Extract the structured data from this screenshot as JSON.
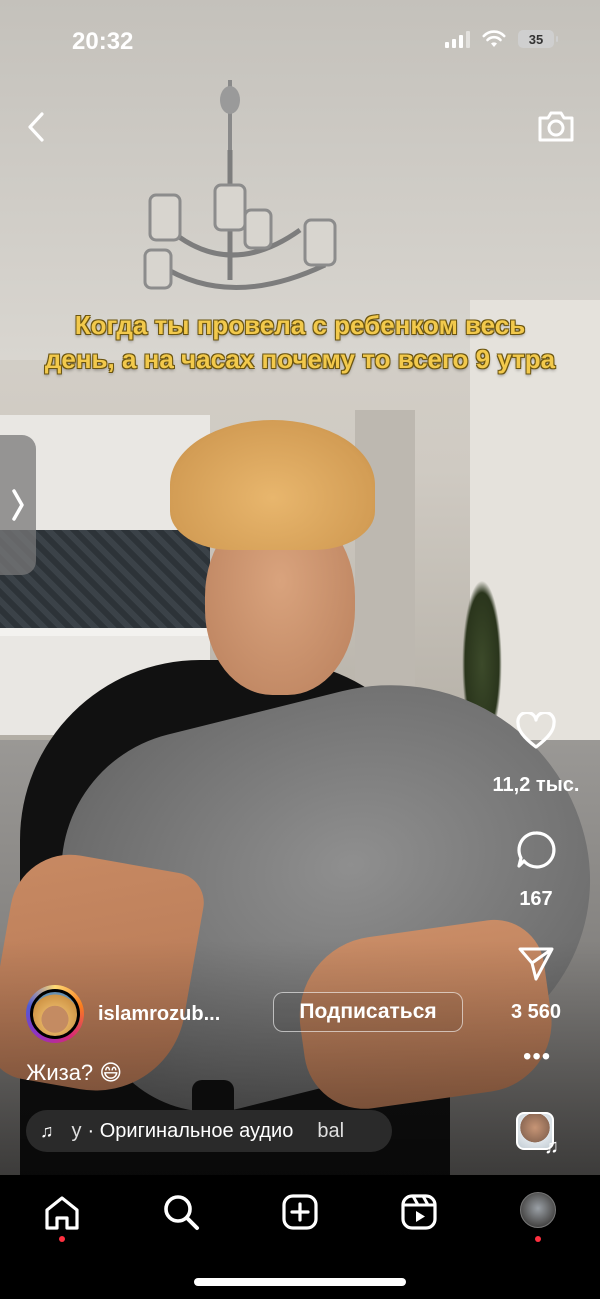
{
  "status_bar": {
    "time": "20:32",
    "battery_level": "35"
  },
  "video": {
    "overlay_caption": "Когда ты провела с ребенком весь день, а на часах почему то всего 9 утра"
  },
  "top_bar": {
    "back_icon": "chevron-left-icon",
    "camera_icon": "camera-icon"
  },
  "actions": {
    "likes_count": "11,2 тыс.",
    "comments_count": "167",
    "shares_count": "3 560"
  },
  "post": {
    "username": "islamrozub...",
    "follow_label": "Подписаться",
    "description": "Жиза? 😄",
    "music_left_fragment": "y",
    "music_label": "· Оригинальное аудио",
    "music_right_fragment": "bal"
  },
  "tab_bar": {
    "items": [
      "home",
      "search",
      "create",
      "reels",
      "profile"
    ]
  },
  "colors": {
    "caption_yellow": "#f2c94c",
    "notification_dot": "#ff3040"
  }
}
